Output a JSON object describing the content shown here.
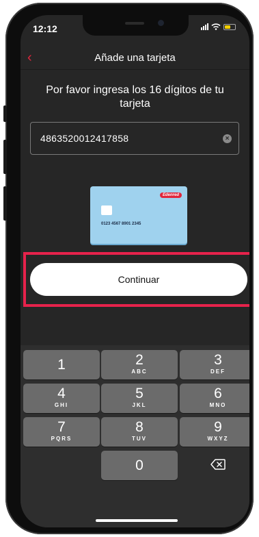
{
  "status_bar": {
    "time": "12:12"
  },
  "nav": {
    "title": "Añade una tarjeta",
    "back_icon": "chevron-left-icon"
  },
  "instruction": "Por favor ingresa los 16 dígitos de tu tarjeta",
  "card_input": {
    "value": "4863520012417858",
    "clear_icon": "clear-circle-icon"
  },
  "card_image": {
    "number": "0123 4567 8901 2345",
    "brand": "Edenred"
  },
  "continue_label": "Continuar",
  "keypad": {
    "keys": [
      {
        "num": "1",
        "letters": ""
      },
      {
        "num": "2",
        "letters": "ABC"
      },
      {
        "num": "3",
        "letters": "DEF"
      },
      {
        "num": "4",
        "letters": "GHI"
      },
      {
        "num": "5",
        "letters": "JKL"
      },
      {
        "num": "6",
        "letters": "MNO"
      },
      {
        "num": "7",
        "letters": "PQRS"
      },
      {
        "num": "8",
        "letters": "TUV"
      },
      {
        "num": "9",
        "letters": "WXYZ"
      },
      {
        "num": "0",
        "letters": ""
      }
    ],
    "delete_icon": "backspace-icon"
  },
  "colors": {
    "accent": "#e0263c",
    "highlight": "#e6224b",
    "background": "#262626"
  }
}
